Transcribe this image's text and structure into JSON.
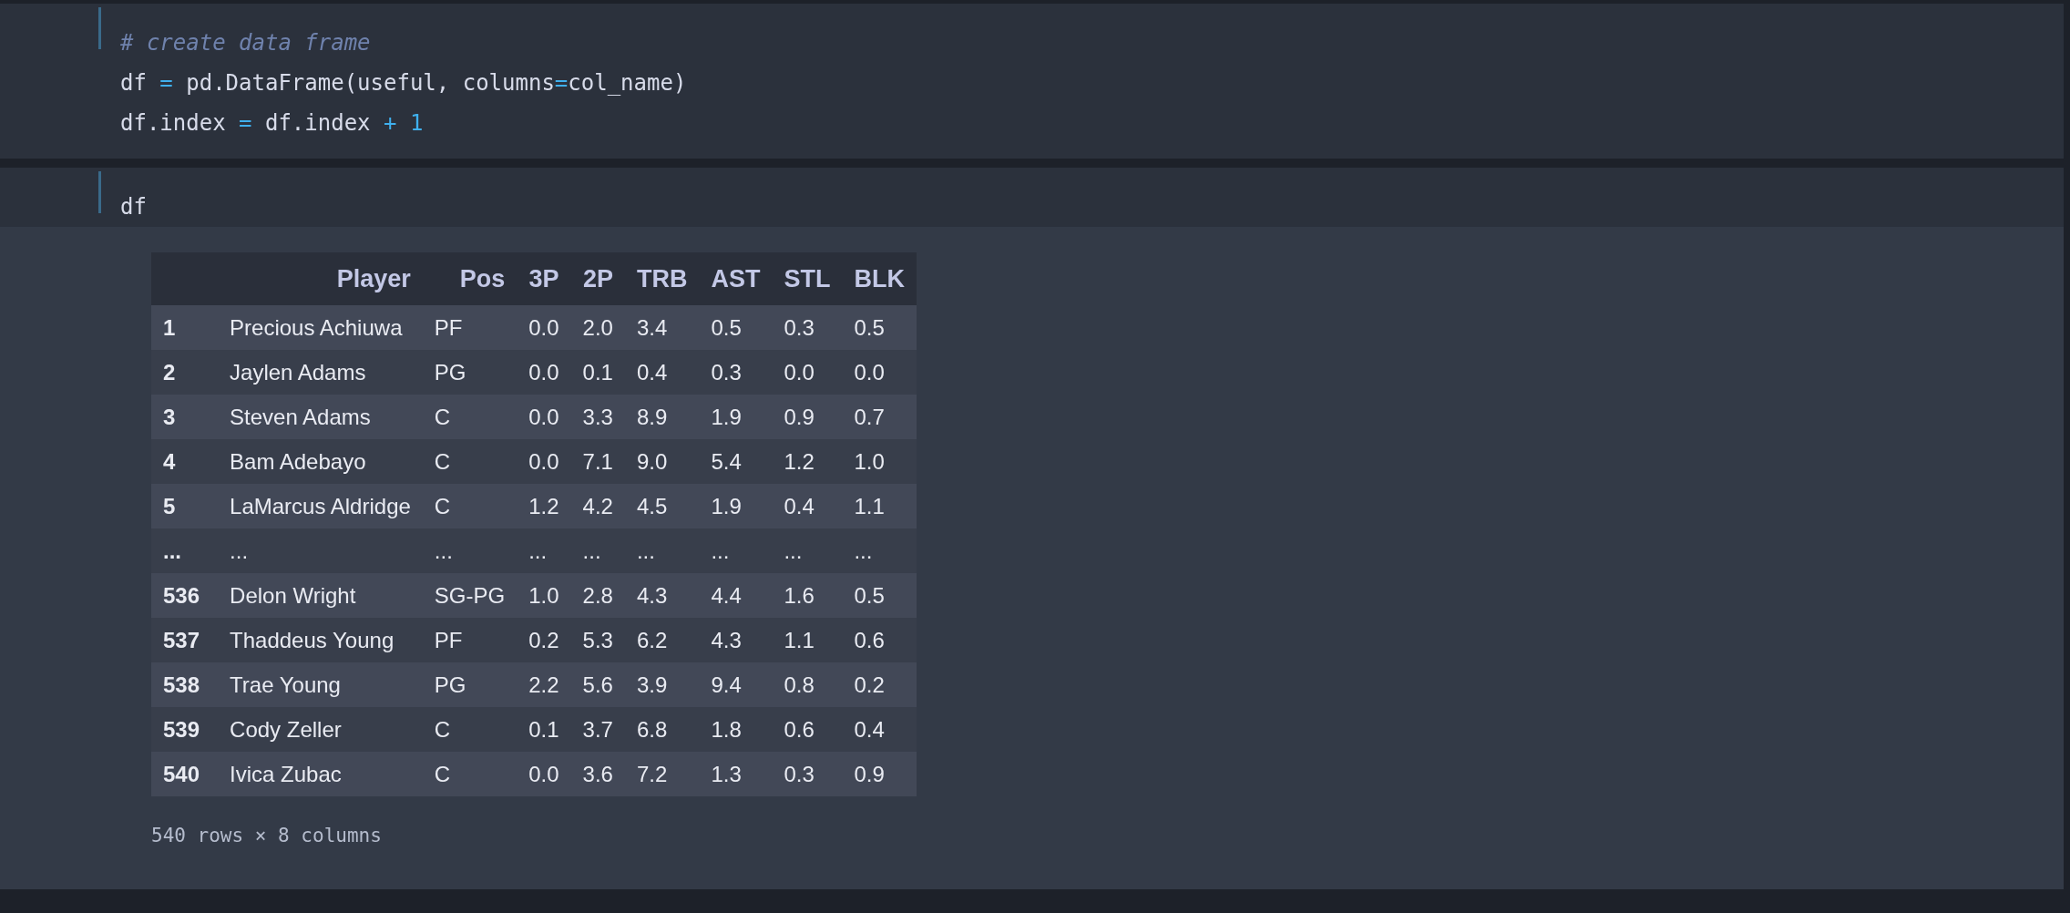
{
  "cells": [
    {
      "kind": "code",
      "lines": [
        [
          {
            "text": "# create data frame",
            "kind": "comment"
          }
        ],
        [
          {
            "text": "df ",
            "kind": "plain"
          },
          {
            "text": "=",
            "kind": "operator"
          },
          {
            "text": " pd.DataFrame(useful, columns",
            "kind": "plain"
          },
          {
            "text": "=",
            "kind": "operator"
          },
          {
            "text": "col_name)",
            "kind": "plain"
          }
        ],
        [
          {
            "text": "df.index ",
            "kind": "plain"
          },
          {
            "text": "=",
            "kind": "operator"
          },
          {
            "text": " df.index ",
            "kind": "plain"
          },
          {
            "text": "+ 1",
            "kind": "operator"
          }
        ]
      ]
    },
    {
      "kind": "code",
      "lines": [
        [
          {
            "text": "df",
            "kind": "plain"
          }
        ]
      ],
      "output": {
        "table": {
          "columns": [
            "",
            "Player",
            "Pos",
            "3P",
            "2P",
            "TRB",
            "AST",
            "STL",
            "BLK"
          ],
          "rows": [
            [
              "1",
              "Precious Achiuwa",
              "PF",
              "0.0",
              "2.0",
              "3.4",
              "0.5",
              "0.3",
              "0.5"
            ],
            [
              "2",
              "Jaylen Adams",
              "PG",
              "0.0",
              "0.1",
              "0.4",
              "0.3",
              "0.0",
              "0.0"
            ],
            [
              "3",
              "Steven Adams",
              "C",
              "0.0",
              "3.3",
              "8.9",
              "1.9",
              "0.9",
              "0.7"
            ],
            [
              "4",
              "Bam Adebayo",
              "C",
              "0.0",
              "7.1",
              "9.0",
              "5.4",
              "1.2",
              "1.0"
            ],
            [
              "5",
              "LaMarcus Aldridge",
              "C",
              "1.2",
              "4.2",
              "4.5",
              "1.9",
              "0.4",
              "1.1"
            ],
            [
              "...",
              "...",
              "...",
              "...",
              "...",
              "...",
              "...",
              "...",
              "..."
            ],
            [
              "536",
              "Delon Wright",
              "SG-PG",
              "1.0",
              "2.8",
              "4.3",
              "4.4",
              "1.6",
              "0.5"
            ],
            [
              "537",
              "Thaddeus Young",
              "PF",
              "0.2",
              "5.3",
              "6.2",
              "4.3",
              "1.1",
              "0.6"
            ],
            [
              "538",
              "Trae Young",
              "PG",
              "2.2",
              "5.6",
              "3.9",
              "9.4",
              "0.8",
              "0.2"
            ],
            [
              "539",
              "Cody Zeller",
              "C",
              "0.1",
              "3.7",
              "6.8",
              "1.8",
              "0.6",
              "0.4"
            ],
            [
              "540",
              "Ivica Zubac",
              "C",
              "0.0",
              "3.6",
              "7.2",
              "1.3",
              "0.3",
              "0.9"
            ]
          ]
        },
        "summary": "540 rows × 8 columns"
      }
    }
  ]
}
